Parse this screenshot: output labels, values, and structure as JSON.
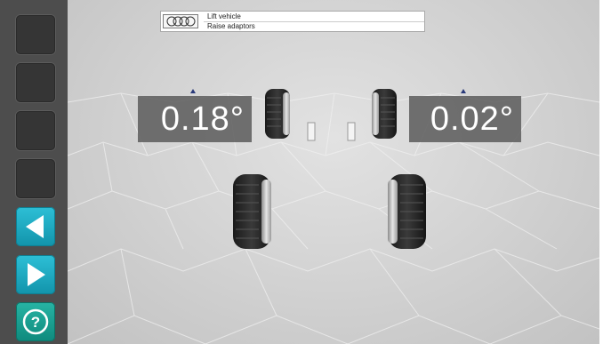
{
  "header": {
    "logo_icon": "audi-rings-logo",
    "line1": "Lift vehicle",
    "line2": "Raise adaptors"
  },
  "readouts": {
    "front_left": "0.18°",
    "front_right": "0.02°"
  },
  "sidebar": {
    "buttons": [
      {
        "name": "blank-button-1",
        "icon": "none"
      },
      {
        "name": "blank-button-2",
        "icon": "none"
      },
      {
        "name": "blank-button-3",
        "icon": "none"
      },
      {
        "name": "blank-button-4",
        "icon": "none"
      },
      {
        "name": "back-button",
        "icon": "triangle-left-icon"
      },
      {
        "name": "forward-button",
        "icon": "triangle-right-icon"
      },
      {
        "name": "help-button",
        "icon": "question-mark-icon"
      }
    ]
  },
  "colors": {
    "sidebar": "#4d4d4d",
    "nav_button": "#1ea9c0",
    "help_button": "#1a9e8f",
    "readout_bg": "#5f5f5f"
  }
}
